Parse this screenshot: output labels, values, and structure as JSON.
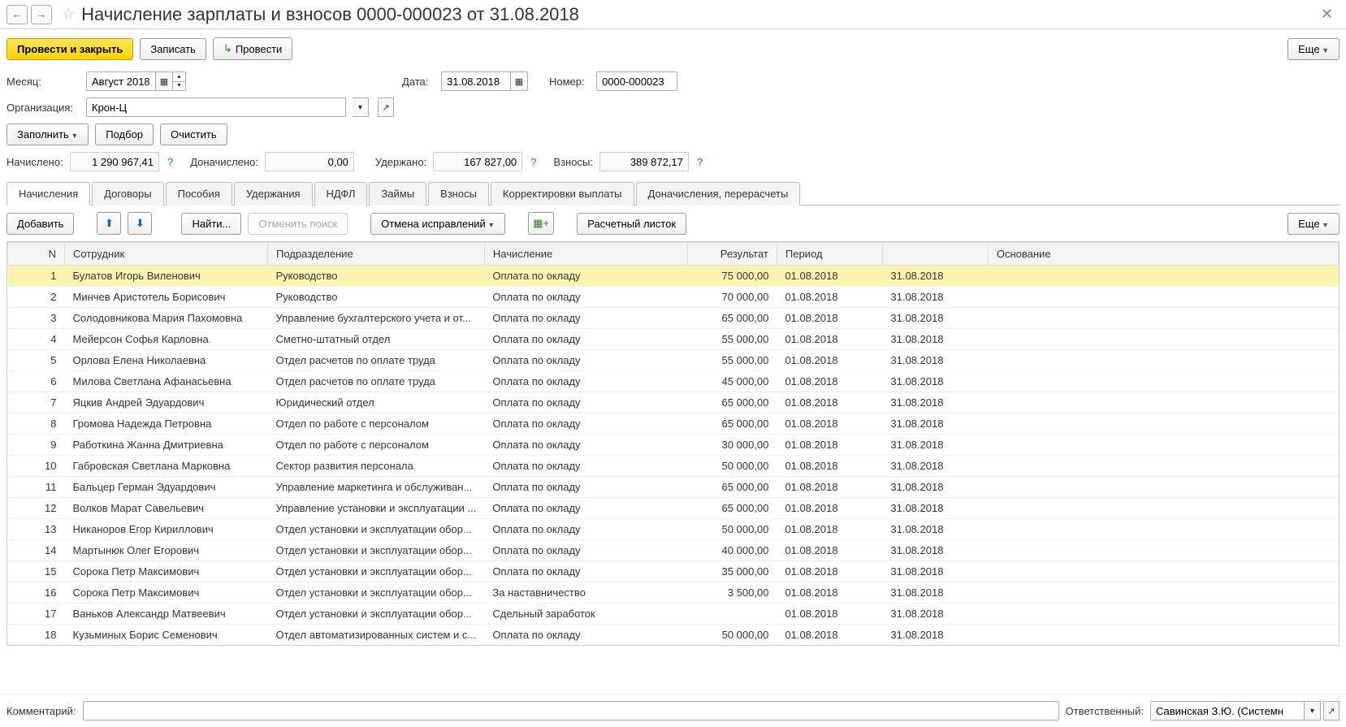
{
  "header": {
    "title": "Начисление зарплаты и взносов 0000-000023 от 31.08.2018"
  },
  "toolbar": {
    "post_close": "Провести и закрыть",
    "save": "Записать",
    "post": "Провести",
    "more": "Еще"
  },
  "form": {
    "month_label": "Месяц:",
    "month_value": "Август 2018",
    "date_label": "Дата:",
    "date_value": "31.08.2018",
    "number_label": "Номер:",
    "number_value": "0000-000023",
    "org_label": "Организация:",
    "org_value": "Крон-Ц",
    "fill": "Заполнить",
    "pick": "Подбор",
    "clear": "Очистить",
    "accrued_label": "Начислено:",
    "accrued_value": "1 290 967,41",
    "reaccrued_label": "Доначислено:",
    "reaccrued_value": "0,00",
    "withheld_label": "Удержано:",
    "withheld_value": "167 827,00",
    "contrib_label": "Взносы:",
    "contrib_value": "389 872,17"
  },
  "tabs": {
    "accruals": "Начисления",
    "contracts": "Договоры",
    "benefits": "Пособия",
    "withholdings": "Удержания",
    "ndfl": "НДФЛ",
    "loans": "Займы",
    "contributions": "Взносы",
    "adjust": "Корректировки выплаты",
    "recalc": "Доначисления, перерасчеты"
  },
  "subbar": {
    "add": "Добавить",
    "find": "Найти...",
    "cancel_search": "Отменить поиск",
    "cancel_fix": "Отмена исправлений",
    "payslip": "Расчетный листок",
    "more": "Еще"
  },
  "table": {
    "headers": {
      "n": "N",
      "employee": "Сотрудник",
      "dept": "Подразделение",
      "calc": "Начисление",
      "result": "Результат",
      "period": "Период",
      "basis": "Основание"
    },
    "rows": [
      {
        "n": "1",
        "emp": "Булатов Игорь Виленович",
        "dept": "Руководство",
        "calc": "Оплата по окладу",
        "res": "75 000,00",
        "p1": "01.08.2018",
        "p2": "31.08.2018"
      },
      {
        "n": "2",
        "emp": "Минчев Аристотель Борисович",
        "dept": "Руководство",
        "calc": "Оплата по окладу",
        "res": "70 000,00",
        "p1": "01.08.2018",
        "p2": "31.08.2018"
      },
      {
        "n": "3",
        "emp": "Солодовникова Мария Пахомовна",
        "dept": "Управление бухгалтерского учета и от...",
        "calc": "Оплата по окладу",
        "res": "65 000,00",
        "p1": "01.08.2018",
        "p2": "31.08.2018"
      },
      {
        "n": "4",
        "emp": "Мейерсон Софья Карловна",
        "dept": "Сметно-штатный отдел",
        "calc": "Оплата по окладу",
        "res": "55 000,00",
        "p1": "01.08.2018",
        "p2": "31.08.2018"
      },
      {
        "n": "5",
        "emp": "Орлова Елена Николаевна",
        "dept": "Отдел расчетов по оплате труда",
        "calc": "Оплата по окладу",
        "res": "55 000,00",
        "p1": "01.08.2018",
        "p2": "31.08.2018"
      },
      {
        "n": "6",
        "emp": "Милова Светлана Афанасьевна",
        "dept": "Отдел расчетов по оплате труда",
        "calc": "Оплата по окладу",
        "res": "45 000,00",
        "p1": "01.08.2018",
        "p2": "31.08.2018"
      },
      {
        "n": "7",
        "emp": "Яцкив Андрей Эдуардович",
        "dept": "Юридический отдел",
        "calc": "Оплата по окладу",
        "res": "65 000,00",
        "p1": "01.08.2018",
        "p2": "31.08.2018"
      },
      {
        "n": "8",
        "emp": "Громова Надежда Петровна",
        "dept": "Отдел по работе с персоналом",
        "calc": "Оплата по окладу",
        "res": "65 000,00",
        "p1": "01.08.2018",
        "p2": "31.08.2018"
      },
      {
        "n": "9",
        "emp": "Работкина Жанна Дмитриевна",
        "dept": "Отдел по работе с персоналом",
        "calc": "Оплата по окладу",
        "res": "30 000,00",
        "p1": "01.08.2018",
        "p2": "31.08.2018"
      },
      {
        "n": "10",
        "emp": "Габровская Светлана Марковна",
        "dept": "Сектор развития персонала",
        "calc": "Оплата по окладу",
        "res": "50 000,00",
        "p1": "01.08.2018",
        "p2": "31.08.2018"
      },
      {
        "n": "11",
        "emp": "Бальцер Герман Эдуардович",
        "dept": "Управление маркетинга и обслуживан...",
        "calc": "Оплата по окладу",
        "res": "65 000,00",
        "p1": "01.08.2018",
        "p2": "31.08.2018"
      },
      {
        "n": "12",
        "emp": "Волков Марат Савельевич",
        "dept": "Управление установки и эксплуатации ...",
        "calc": "Оплата по окладу",
        "res": "65 000,00",
        "p1": "01.08.2018",
        "p2": "31.08.2018"
      },
      {
        "n": "13",
        "emp": "Никаноров Егор Кириллович",
        "dept": "Отдел установки и эксплуатации обор...",
        "calc": "Оплата по окладу",
        "res": "50 000,00",
        "p1": "01.08.2018",
        "p2": "31.08.2018"
      },
      {
        "n": "14",
        "emp": "Мартынюк Олег Егорович",
        "dept": "Отдел установки и эксплуатации обор...",
        "calc": "Оплата по окладу",
        "res": "40 000,00",
        "p1": "01.08.2018",
        "p2": "31.08.2018"
      },
      {
        "n": "15",
        "emp": "Сорока Петр Максимович",
        "dept": "Отдел установки и эксплуатации обор...",
        "calc": "Оплата по окладу",
        "res": "35 000,00",
        "p1": "01.08.2018",
        "p2": "31.08.2018"
      },
      {
        "n": "16",
        "emp": "Сорока Петр Максимович",
        "dept": "Отдел установки и эксплуатации обор...",
        "calc": "За наставничество",
        "res": "3 500,00",
        "p1": "01.08.2018",
        "p2": "31.08.2018"
      },
      {
        "n": "17",
        "emp": "Ваньков Александр Матвеевич",
        "dept": "Отдел установки и эксплуатации обор...",
        "calc": "Сдельный заработок",
        "res": "",
        "p1": "01.08.2018",
        "p2": "31.08.2018"
      },
      {
        "n": "18",
        "emp": "Кузьминых Борис Семенович",
        "dept": "Отдел автоматизированных систем и с...",
        "calc": "Оплата по окладу",
        "res": "50 000,00",
        "p1": "01.08.2018",
        "p2": "31.08.2018"
      }
    ]
  },
  "footer": {
    "comment_label": "Комментарий:",
    "responsible_label": "Ответственный:",
    "responsible_value": "Савинская З.Ю. (Системн"
  }
}
